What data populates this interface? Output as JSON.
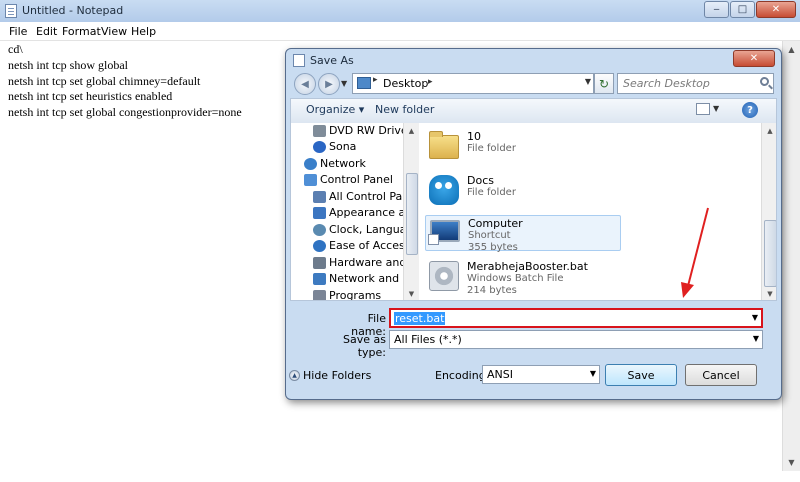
{
  "notepad": {
    "title": "Untitled - Notepad",
    "menu": [
      "File",
      "Edit",
      "Format",
      "View",
      "Help"
    ],
    "lines": [
      "cd\\",
      "netsh int tcp show global",
      "netsh int tcp set global chimney=default",
      "netsh int tcp set heuristics enabled",
      "netsh int tcp set global congestionprovider=none"
    ],
    "window_buttons": {
      "minimize": "‒",
      "maximize": "□",
      "close": "✕"
    }
  },
  "dialog": {
    "title": "Save As",
    "close_glyph": "✕",
    "address": {
      "location": "Desktop",
      "separator": "▸",
      "arrow": "▸"
    },
    "search_placeholder": "Search Desktop",
    "toolbar": {
      "organize": "Organize ▾",
      "new_folder": "New folder",
      "help": "?"
    },
    "nav_items": [
      {
        "label": "DVD RW Drive",
        "icon": "dvd-drive-icon",
        "color": "#7f8c99"
      },
      {
        "label": "Sona",
        "icon": "bluetooth-icon",
        "color": "#2a66c4"
      },
      {
        "label": "Network",
        "icon": "network-icon",
        "color": "#3a7fc9"
      },
      {
        "label": "Control Panel",
        "icon": "control-panel-icon",
        "color": "#4f8fd6"
      },
      {
        "label": "All Control Pa",
        "icon": "all-control-panel-icon",
        "color": "#5b7fb1"
      },
      {
        "label": "Appearance ar",
        "icon": "appearance-icon",
        "color": "#3c76c1"
      },
      {
        "label": "Clock, Langua",
        "icon": "clock-icon",
        "color": "#5a8ab0"
      },
      {
        "label": "Ease of Access",
        "icon": "ease-of-access-icon",
        "color": "#2f73c2"
      },
      {
        "label": "Hardware and",
        "icon": "hardware-icon",
        "color": "#6d7b8c"
      },
      {
        "label": "Network and I",
        "icon": "network-internet-icon",
        "color": "#3d7ac0"
      },
      {
        "label": "Programs",
        "icon": "programs-icon",
        "color": "#7b8596"
      }
    ],
    "files": [
      {
        "name": "10",
        "type": "File folder",
        "size": "",
        "icon": "folder-icon"
      },
      {
        "name": "Docs",
        "type": "File folder",
        "size": "",
        "icon": "docs-folder-icon"
      },
      {
        "name": "Computer",
        "type": "Shortcut",
        "size": "355 bytes",
        "icon": "computer-shortcut-icon"
      },
      {
        "name": "MerabhejaBooster.bat",
        "type": "Windows Batch File",
        "size": "214 bytes",
        "icon": "batch-file-icon"
      }
    ],
    "file_name_label": "File name:",
    "file_name_value": "reset.bat",
    "save_type_label": "Save as type:",
    "save_type_value": "All Files  (*.*)",
    "hide_folders": "Hide Folders",
    "encoding_label": "Encoding:",
    "encoding_value": "ANSI",
    "save_button": "Save",
    "cancel_button": "Cancel",
    "dropdown_glyph": "▼"
  },
  "colors": {
    "annotation": "#e02020",
    "selection": "#3399ff",
    "highlight_border": "#d8141c"
  }
}
